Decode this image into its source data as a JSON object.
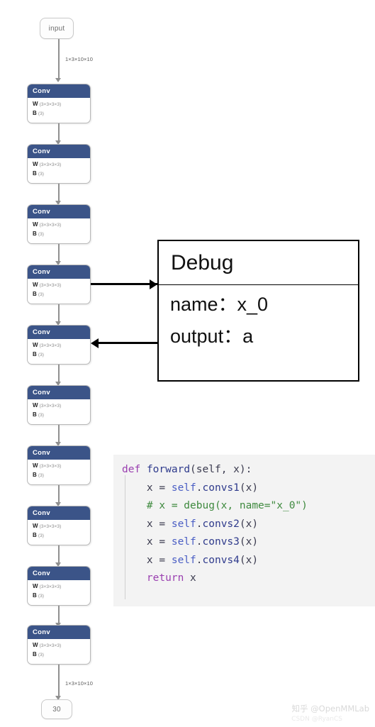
{
  "graph": {
    "input_node": {
      "label": "input"
    },
    "output_node": {
      "label": "30"
    },
    "top_edge_label": "1×3×10×10",
    "bottom_edge_label": "1×3×10×10",
    "block_header": "Conv",
    "weight_key": "W",
    "weight_shape": "(3×3×3×3)",
    "bias_key": "B",
    "bias_shape": "(3)",
    "block_count": 10,
    "blocks": [
      {
        "header": "Conv",
        "weight_key": "W",
        "weight_shape": "(3×3×3×3)",
        "bias_key": "B",
        "bias_shape": "(3)"
      },
      {
        "header": "Conv",
        "weight_key": "W",
        "weight_shape": "(3×3×3×3)",
        "bias_key": "B",
        "bias_shape": "(3)"
      },
      {
        "header": "Conv",
        "weight_key": "W",
        "weight_shape": "(3×3×3×3)",
        "bias_key": "B",
        "bias_shape": "(3)"
      },
      {
        "header": "Conv",
        "weight_key": "W",
        "weight_shape": "(3×3×3×3)",
        "bias_key": "B",
        "bias_shape": "(3)"
      },
      {
        "header": "Conv",
        "weight_key": "W",
        "weight_shape": "(3×3×3×3)",
        "bias_key": "B",
        "bias_shape": "(3)"
      },
      {
        "header": "Conv",
        "weight_key": "W",
        "weight_shape": "(3×3×3×3)",
        "bias_key": "B",
        "bias_shape": "(3)"
      },
      {
        "header": "Conv",
        "weight_key": "W",
        "weight_shape": "(3×3×3×3)",
        "bias_key": "B",
        "bias_shape": "(3)"
      },
      {
        "header": "Conv",
        "weight_key": "W",
        "weight_shape": "(3×3×3×3)",
        "bias_key": "B",
        "bias_shape": "(3)"
      },
      {
        "header": "Conv",
        "weight_key": "W",
        "weight_shape": "(3×3×3×3)",
        "bias_key": "B",
        "bias_shape": "(3)"
      },
      {
        "header": "Conv",
        "weight_key": "W",
        "weight_shape": "(3×3×3×3)",
        "bias_key": "B",
        "bias_shape": "(3)"
      }
    ],
    "colors": {
      "block_header_bg": "#3b5488",
      "block_border": "#b8b8b8",
      "edge": "#909090",
      "node_border": "#c9c9c9"
    }
  },
  "debug_callout": {
    "title": "Debug",
    "fields": [
      {
        "key": "name",
        "sep": "：",
        "value": "x_0"
      },
      {
        "key": "output",
        "sep": "：",
        "value": "a"
      }
    ],
    "name_line": "name：x_0",
    "output_line": "output：a",
    "border_color": "#000000"
  },
  "code": {
    "language": "python",
    "background": "#f3f3f3",
    "lines": [
      {
        "text": "def forward(self, x):",
        "tokens": [
          [
            "kw",
            "def"
          ],
          [
            "pl",
            " "
          ],
          [
            "fn",
            "forward"
          ],
          [
            "pl",
            "(self, x):"
          ]
        ]
      },
      {
        "text": "    x = self.convs1(x)",
        "tokens": [
          [
            "pl",
            "    x = "
          ],
          [
            "sf",
            "self"
          ],
          [
            "pl",
            "."
          ],
          [
            "fn",
            "convs1"
          ],
          [
            "pl",
            "(x)"
          ]
        ]
      },
      {
        "text": "    # x = debug(x, name=\"x_0\")",
        "tokens": [
          [
            "cm",
            "    # x = debug(x, name=\"x_0\")"
          ]
        ]
      },
      {
        "text": "    x = self.convs2(x)",
        "tokens": [
          [
            "pl",
            "    x = "
          ],
          [
            "sf",
            "self"
          ],
          [
            "pl",
            "."
          ],
          [
            "fn",
            "convs2"
          ],
          [
            "pl",
            "(x)"
          ]
        ]
      },
      {
        "text": "    x = self.convs3(x)",
        "tokens": [
          [
            "pl",
            "    x = "
          ],
          [
            "sf",
            "self"
          ],
          [
            "pl",
            "."
          ],
          [
            "fn",
            "convs3"
          ],
          [
            "pl",
            "(x)"
          ]
        ]
      },
      {
        "text": "    x = self.convs4(x)",
        "tokens": [
          [
            "pl",
            "    x = "
          ],
          [
            "sf",
            "self"
          ],
          [
            "pl",
            "."
          ],
          [
            "fn",
            "convs4"
          ],
          [
            "pl",
            "(x)"
          ]
        ]
      },
      {
        "text": "    return x",
        "tokens": [
          [
            "pl",
            "    "
          ],
          [
            "kw",
            "return"
          ],
          [
            "pl",
            " x"
          ]
        ]
      }
    ],
    "colors": {
      "keyword": "#9a3fb0",
      "function": "#2e3a8c",
      "comment": "#3f8a3f",
      "self": "#4a5ec4",
      "plain": "#3b3b4f"
    }
  },
  "watermarks": {
    "zhihu": "知乎 @OpenMMLab",
    "csdn": "CSDN @RyanCS"
  }
}
